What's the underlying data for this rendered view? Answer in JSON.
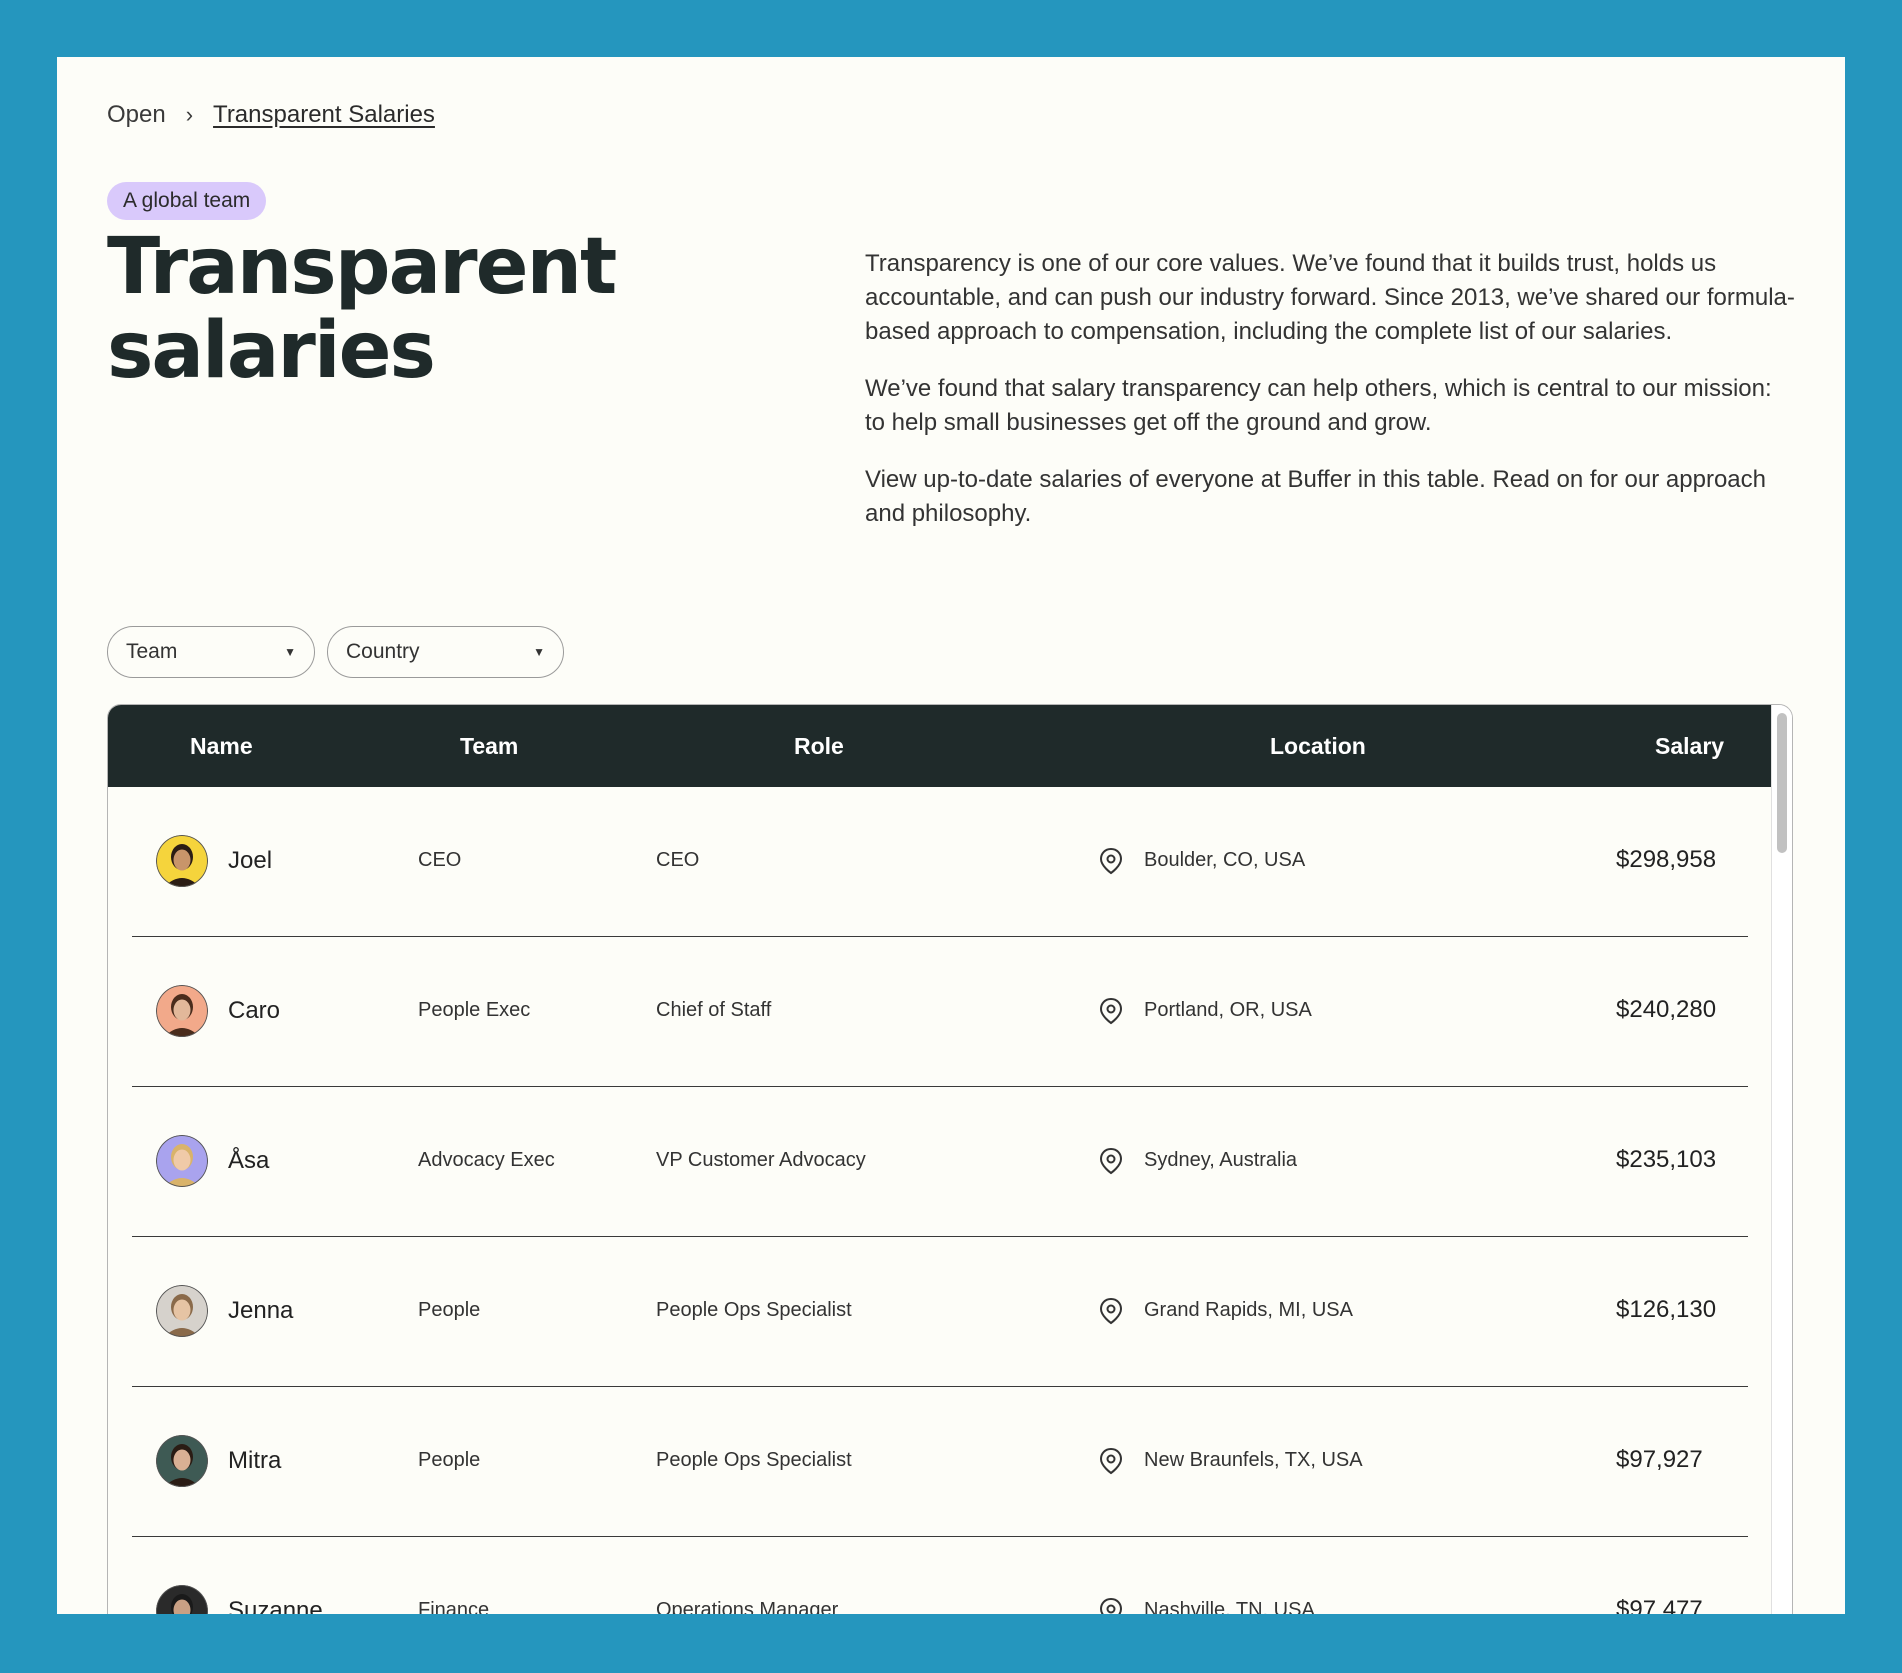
{
  "breadcrumb": {
    "parent": "Open",
    "separator": "›",
    "current": "Transparent Salaries"
  },
  "badge": "A global team",
  "title": "Transparent salaries",
  "intro": [
    "Transparency is one of our core values. We’ve found that it builds trust, holds us accountable, and can push our industry forward. Since 2013, we’ve shared our formula-based approach to compensation, including the complete list of our salaries.",
    "We’ve found that salary transparency can help others, which is central to our mission: to help small businesses get off the ground and grow.",
    "View up-to-date salaries of everyone at Buffer in this table. Read on for our approach and philosophy."
  ],
  "filters": {
    "team": "Team",
    "country": "Country"
  },
  "table": {
    "headers": {
      "name": "Name",
      "team": "Team",
      "role": "Role",
      "location": "Location",
      "salary": "Salary"
    },
    "rows": [
      {
        "name": "Joel",
        "team": "CEO",
        "role": "CEO",
        "location": "Boulder, CO, USA",
        "salary": "$298,958",
        "avatar_bg": "#f5d43c",
        "skin": "#c8956a",
        "hair": "#2b1d14"
      },
      {
        "name": "Caro",
        "team": "People Exec",
        "role": "Chief of Staff",
        "location": "Portland, OR, USA",
        "salary": "$240,280",
        "avatar_bg": "#f2a98a",
        "skin": "#e2b89a",
        "hair": "#4a2c1c"
      },
      {
        "name": "Åsa",
        "team": "Advocacy Exec",
        "role": "VP Customer Advocacy",
        "location": "Sydney, Australia",
        "salary": "$235,103",
        "avatar_bg": "#a9a3ee",
        "skin": "#f0caa8",
        "hair": "#d9b36a"
      },
      {
        "name": "Jenna",
        "team": "People",
        "role": "People Ops Specialist",
        "location": "Grand Rapids, MI, USA",
        "salary": "$126,130",
        "avatar_bg": "#d6d2cc",
        "skin": "#e6c4a4",
        "hair": "#8a6a4a"
      },
      {
        "name": "Mitra",
        "team": "People",
        "role": "People Ops Specialist",
        "location": "New Braunfels, TX, USA",
        "salary": "$97,927",
        "avatar_bg": "#3e5a54",
        "skin": "#d9b094",
        "hair": "#2a1c14"
      },
      {
        "name": "Suzanne",
        "team": "Finance",
        "role": "Operations Manager",
        "location": "Nashville, TN, USA",
        "salary": "$97,477",
        "avatar_bg": "#2a2a2a",
        "skin": "#c9a084",
        "hair": "#1a1a1a"
      }
    ]
  }
}
